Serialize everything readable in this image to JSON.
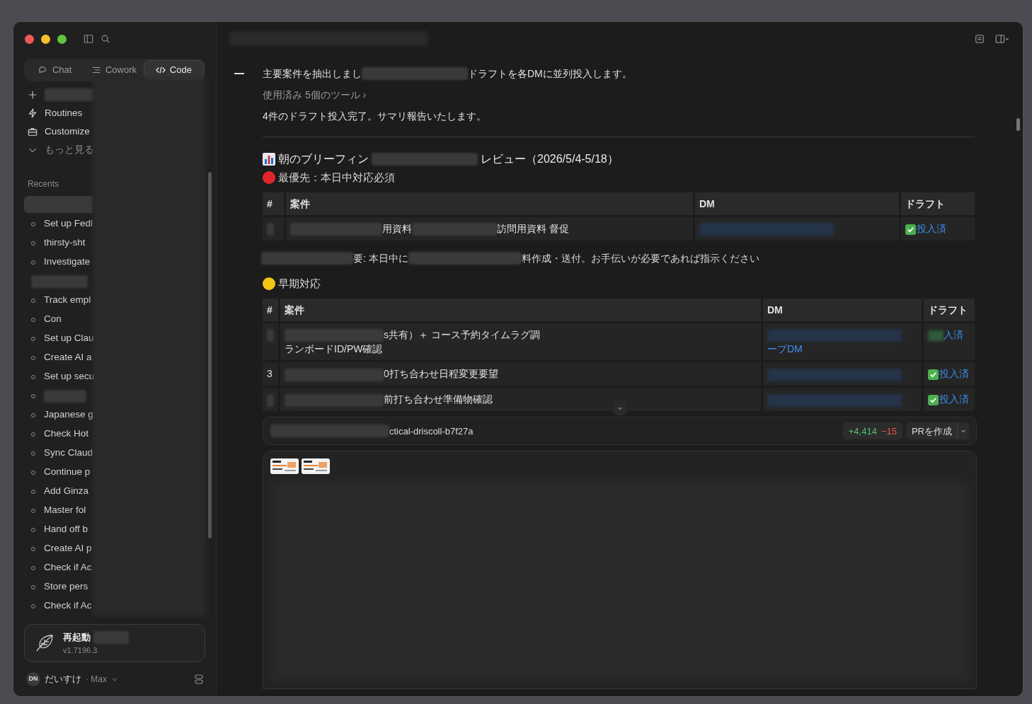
{
  "sidebar": {
    "tabs": [
      {
        "label": "Chat",
        "selected": false
      },
      {
        "label": "Cowork",
        "selected": false
      },
      {
        "label": "Code",
        "selected": true
      }
    ],
    "nav": [
      {
        "kind": "new"
      },
      {
        "kind": "item",
        "label": "Routines"
      },
      {
        "kind": "item",
        "label": "Customize"
      },
      {
        "kind": "more",
        "label": "もっと見る"
      }
    ],
    "recents_label": "Recents",
    "recents": [
      {
        "kind": "highlight"
      },
      {
        "kind": "item",
        "label": "Set up Fedl"
      },
      {
        "kind": "item",
        "label": "thirsty-sht"
      },
      {
        "kind": "item",
        "label": "Investigate"
      },
      {
        "kind": "gap"
      },
      {
        "kind": "item",
        "label": "Track empl"
      },
      {
        "kind": "item",
        "label": "Con"
      },
      {
        "kind": "item",
        "label": "Set up Clau"
      },
      {
        "kind": "item",
        "label": "Create AI a"
      },
      {
        "kind": "item",
        "label": "Set up secu"
      },
      {
        "kind": "redacted"
      },
      {
        "kind": "item",
        "label": "Japanese g"
      },
      {
        "kind": "item",
        "label": "Check Hot"
      },
      {
        "kind": "item",
        "label": "Sync Claud"
      },
      {
        "kind": "item",
        "label": "Continue p"
      },
      {
        "kind": "item",
        "label": "Add Ginza"
      },
      {
        "kind": "item",
        "label": "Master fol"
      },
      {
        "kind": "item",
        "label": "Hand off b"
      },
      {
        "kind": "item",
        "label": "Create AI p"
      },
      {
        "kind": "item",
        "label": "Check if Ac"
      },
      {
        "kind": "item",
        "label": "Store pers"
      },
      {
        "kind": "item",
        "label": "Check if Ac"
      }
    ],
    "update": {
      "title": "再起動",
      "version": "v1.7196.3"
    },
    "user": {
      "initials": "DN",
      "name": "だいすけ",
      "plan": "· Max"
    }
  },
  "messages": [
    {
      "kind": "text",
      "parts": [
        "主要案件を抽出しまし",
        "ドラフトを各DMに並列投入します。"
      ]
    },
    {
      "kind": "tools",
      "parts": [
        "使用済み 5個のツール ›"
      ]
    },
    {
      "kind": "text",
      "parts": [
        "4件のドラフト投入完了。サマリ報告いたします。"
      ]
    }
  ],
  "report": {
    "title_parts": [
      "朝のブリーフィン",
      "レビュー（2026/5/4-5/18）"
    ],
    "sections": [
      {
        "color": "#e0262b",
        "title": "最優先：本日中対応必須",
        "columns": [
          "#",
          "案件",
          "DM",
          "ドラフト"
        ],
        "rows": [
          {
            "num": "",
            "case": [
              "用資料",
              "訪問用資料 督促"
            ],
            "dm": "",
            "draft": "投入済",
            "checked": true
          }
        ],
        "note": [
          "要: 本日中に",
          "料作成・送付。お手伝いが必要であれば指示ください"
        ]
      },
      {
        "color": "#f5c518",
        "title": "早期対応",
        "columns": [
          "#",
          "案件",
          "DM",
          "ドラフト"
        ],
        "rows": [
          {
            "num": "",
            "case": [
              "s共有）＋ コース予約タイムラグ調",
              "ランボードID/PW確認"
            ],
            "dm": "ープDM",
            "draft": "入済",
            "checked": false
          },
          {
            "num": "3",
            "case": [
              "0打ち合わせ日程変更要望"
            ],
            "dm": "",
            "draft": "投入済",
            "checked": true
          },
          {
            "num": "",
            "case": [
              "前打ち合わせ準備物確認"
            ],
            "dm": "",
            "draft": "投入済",
            "checked": true
          }
        ]
      }
    ]
  },
  "branch": {
    "name": "ctical-driscoll-b7f27a",
    "added": "+4,414",
    "removed": "−15",
    "pr_button": "PRを作成"
  }
}
